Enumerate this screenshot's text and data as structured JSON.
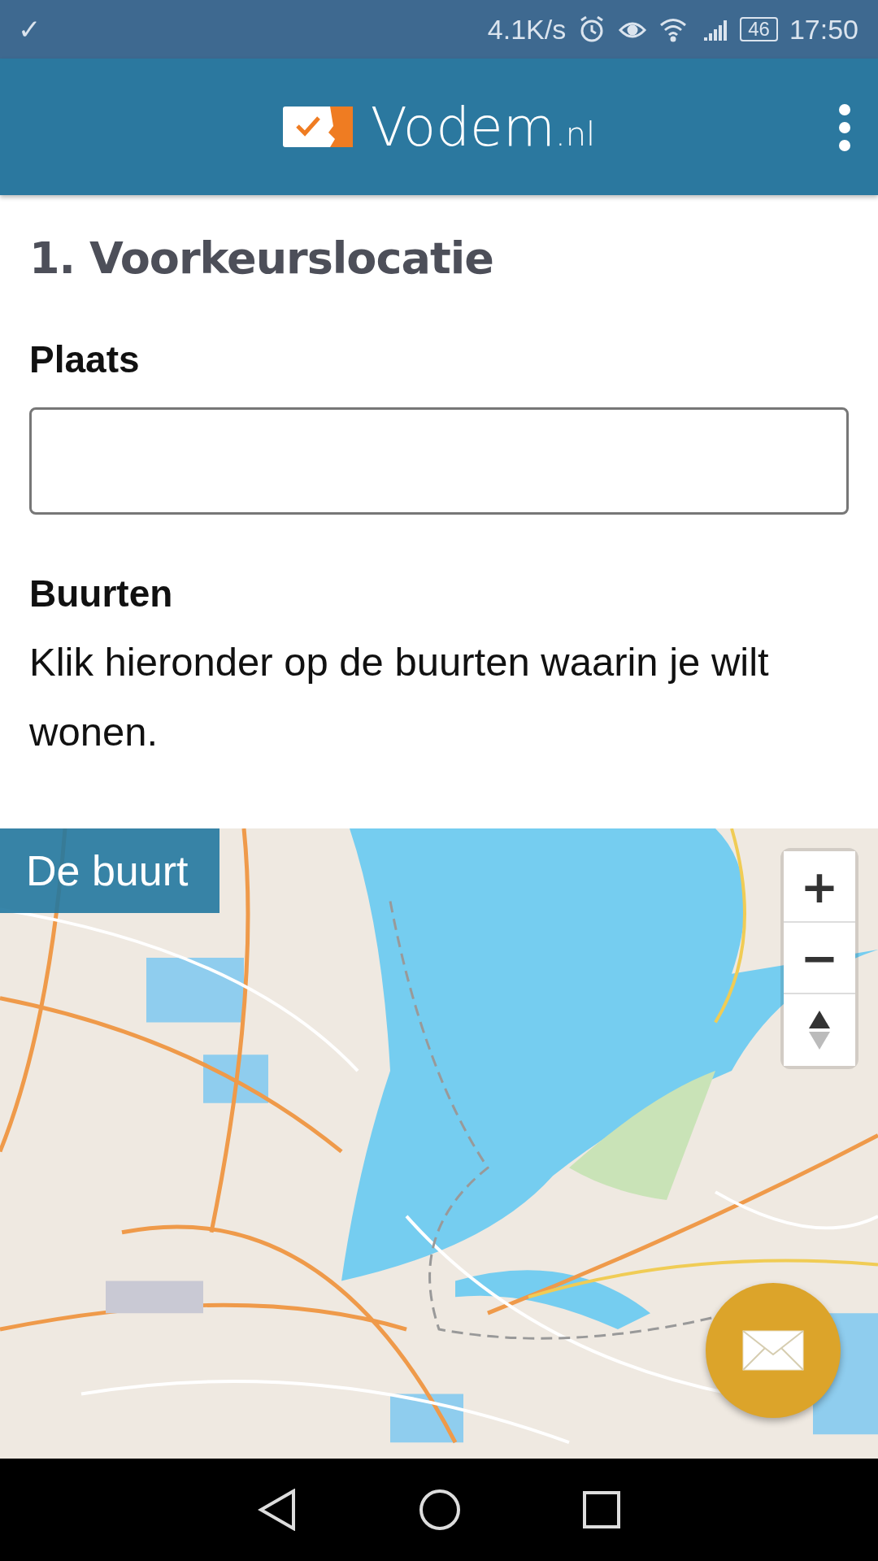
{
  "status_bar": {
    "notification": "✓",
    "speed": "4.1K/s",
    "battery": "46",
    "time": "17:50"
  },
  "header": {
    "brand": "Vodem",
    "brand_suffix": ".nl"
  },
  "section_title": "1. Voorkeurslocatie",
  "place": {
    "label": "Plaats"
  },
  "neighbourhoods": {
    "label": "Buurten",
    "text": "Klik hieronder op de buurten waarin je wilt wonen."
  },
  "map": {
    "kind": "picture",
    "overlay_label": "De buurt",
    "zoom_in": "+",
    "zoom_out": "−"
  }
}
